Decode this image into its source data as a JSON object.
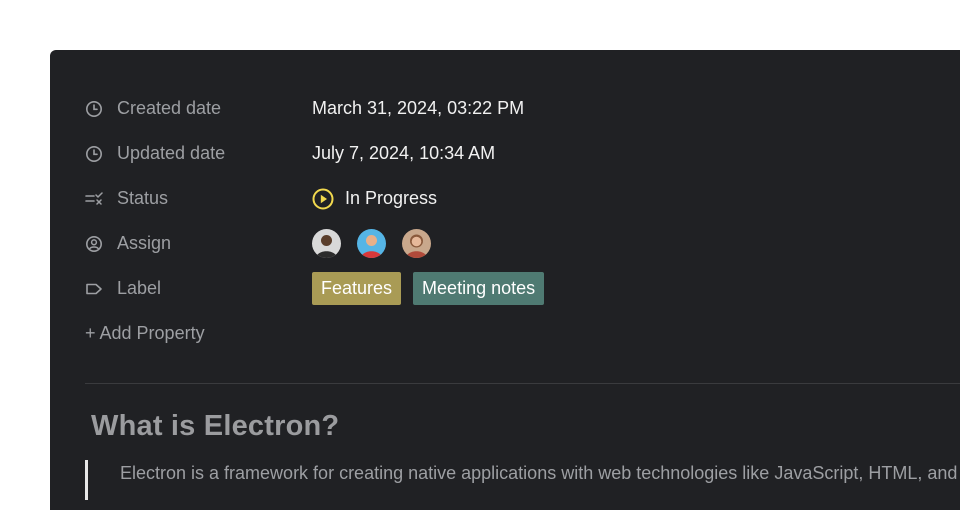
{
  "properties": {
    "created": {
      "label": "Created date",
      "value": "March 31, 2024, 03:22 PM",
      "icon": "clock-icon"
    },
    "updated": {
      "label": "Updated date",
      "value": "July 7, 2024, 10:34 AM",
      "icon": "clock-icon"
    },
    "status": {
      "label": "Status",
      "value": "In Progress",
      "icon": "status-list-icon",
      "status_icon": "play-circle-icon",
      "status_color": "#f2d94e"
    },
    "assign": {
      "label": "Assign",
      "icon": "user-circle-icon",
      "avatars": [
        {
          "name": "avatar-1",
          "bg": "#d9d9d9",
          "skin": "#5a3e2b",
          "shirt": "#2c2c2c"
        },
        {
          "name": "avatar-2",
          "bg": "#55b5e6",
          "skin": "#e8b08a",
          "shirt": "#d8383a"
        },
        {
          "name": "avatar-3",
          "bg": "#c9a88c",
          "skin": "#e7b99a",
          "shirt": "#b14a3a"
        }
      ]
    },
    "label": {
      "label": "Label",
      "icon": "tag-icon",
      "tags": [
        {
          "text": "Features",
          "color": "#a99b55"
        },
        {
          "text": "Meeting notes",
          "color": "#4f7a72"
        }
      ]
    }
  },
  "add_property": "+ Add Property",
  "doc": {
    "heading": "What is Electron?",
    "quote": "Electron is a framework for creating native applications with web technologies like JavaScript, HTML, and CSS."
  }
}
